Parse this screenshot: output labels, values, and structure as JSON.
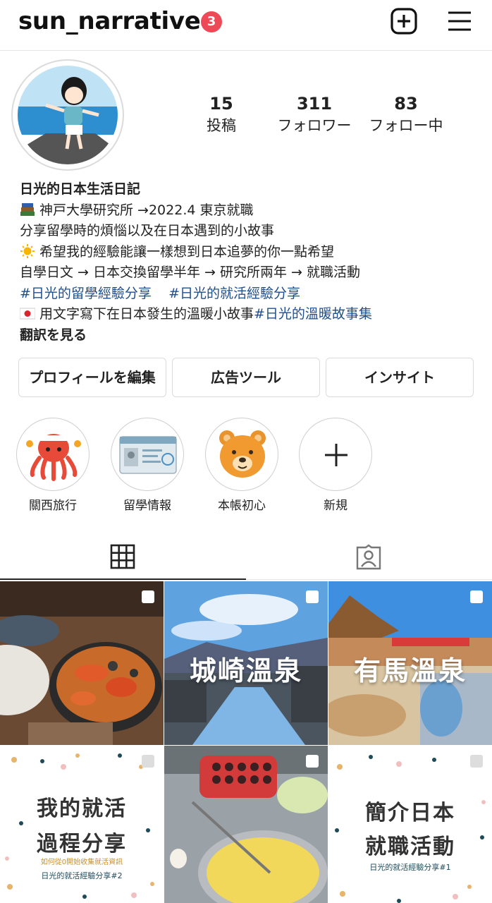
{
  "header": {
    "username": "sun_narrative",
    "notification_count": "3",
    "new_post_icon": "plus-square-icon",
    "menu_icon": "hamburger-menu-icon"
  },
  "profile": {
    "stats": [
      {
        "value": "15",
        "label": "投稿"
      },
      {
        "value": "311",
        "label": "フォロワー"
      },
      {
        "value": "83",
        "label": "フォロー中"
      }
    ],
    "bio": {
      "name": "日光的日本生活日記",
      "line1": "神戸大學研究所 →2022.4 東京就職",
      "line2": "分享留學時的煩惱以及在日本遇到的小故事",
      "line3": "希望我的經驗能讓一樣想到日本追夢的你一點希望",
      "line4": "自學日文 → 日本交換留學半年 → 研究所兩年 → 就職活動",
      "hashtag1": "#日光的留學經驗分享",
      "hashtag2": "#日光的就活經驗分享",
      "line6_text": "用文字寫下在日本發生的溫暖小故事",
      "hashtag3": "#日光的溫暖故事集",
      "translate": "翻訳を見る"
    }
  },
  "actions": {
    "edit_profile": "プロフィールを編集",
    "ad_tools": "広告ツール",
    "insights": "インサイト"
  },
  "highlights": [
    {
      "label": "關西旅行",
      "icon": "octopus-icon"
    },
    {
      "label": "留學情報",
      "icon": "visa-card-icon"
    },
    {
      "label": "本帳初心",
      "icon": "bear-icon"
    },
    {
      "label": "新規",
      "icon": "plus-icon"
    }
  ],
  "tabs": {
    "grid_icon": "grid-icon",
    "tagged_icon": "tagged-person-icon"
  },
  "posts": [
    {
      "title": ""
    },
    {
      "title": "城崎溫泉"
    },
    {
      "title": "有馬溫泉"
    },
    {
      "title": "我的就活",
      "title2": "過程分享",
      "subtitle": "如何從0開始收集就活資訊",
      "footer": "日光的就活經驗分享#2"
    },
    {
      "title": ""
    },
    {
      "title": "簡介日本",
      "title2": "就職活動",
      "footer": "日光的就活經驗分享#1"
    }
  ],
  "colors": {
    "badge": "#ed4956",
    "hashtag": "#1f4e8c",
    "border": "#dbdbdb"
  }
}
